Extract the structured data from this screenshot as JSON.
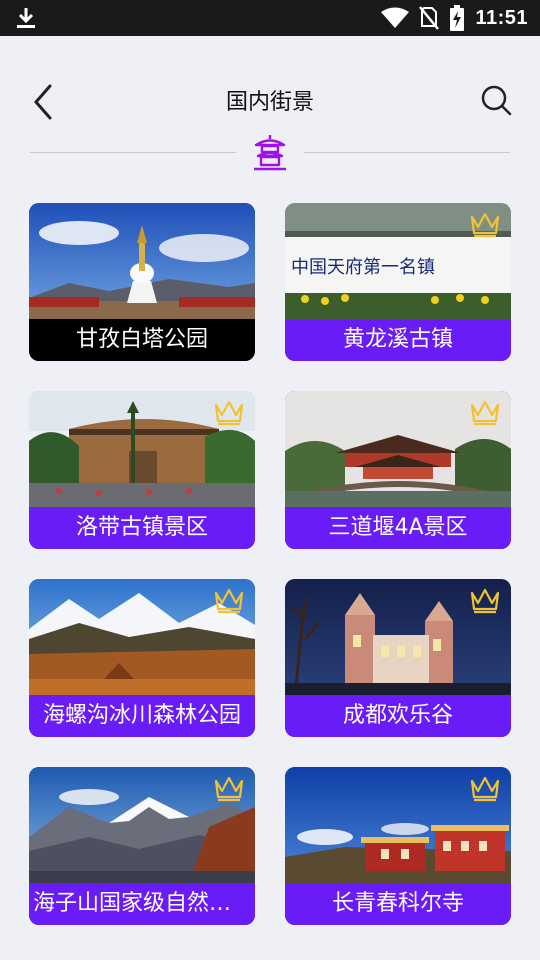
{
  "status_bar": {
    "time": "11:51",
    "icons": [
      "download-icon",
      "wifi-icon",
      "no-sim-icon",
      "battery-charging-icon"
    ]
  },
  "header": {
    "title": "国内街景",
    "back_icon": "back-chevron-icon",
    "search_icon": "search-icon",
    "emblem_icon": "pagoda-icon"
  },
  "colors": {
    "accent": "#6a1cf6",
    "emblem": "#a010e8",
    "crown": "#f2c230",
    "background": "#eef0f6"
  },
  "attractions": [
    {
      "name": "甘孜白塔公园",
      "premium": false
    },
    {
      "name": "黄龙溪古镇",
      "premium": true
    },
    {
      "name": "洛带古镇景区",
      "premium": true
    },
    {
      "name": "三道堰4A景区",
      "premium": true
    },
    {
      "name": "海螺沟冰川森林公园",
      "premium": true
    },
    {
      "name": "成都欢乐谷",
      "premium": true
    },
    {
      "name": "海子山国家级自然保...",
      "premium": true
    },
    {
      "name": "长青春科尔寺",
      "premium": true
    }
  ]
}
